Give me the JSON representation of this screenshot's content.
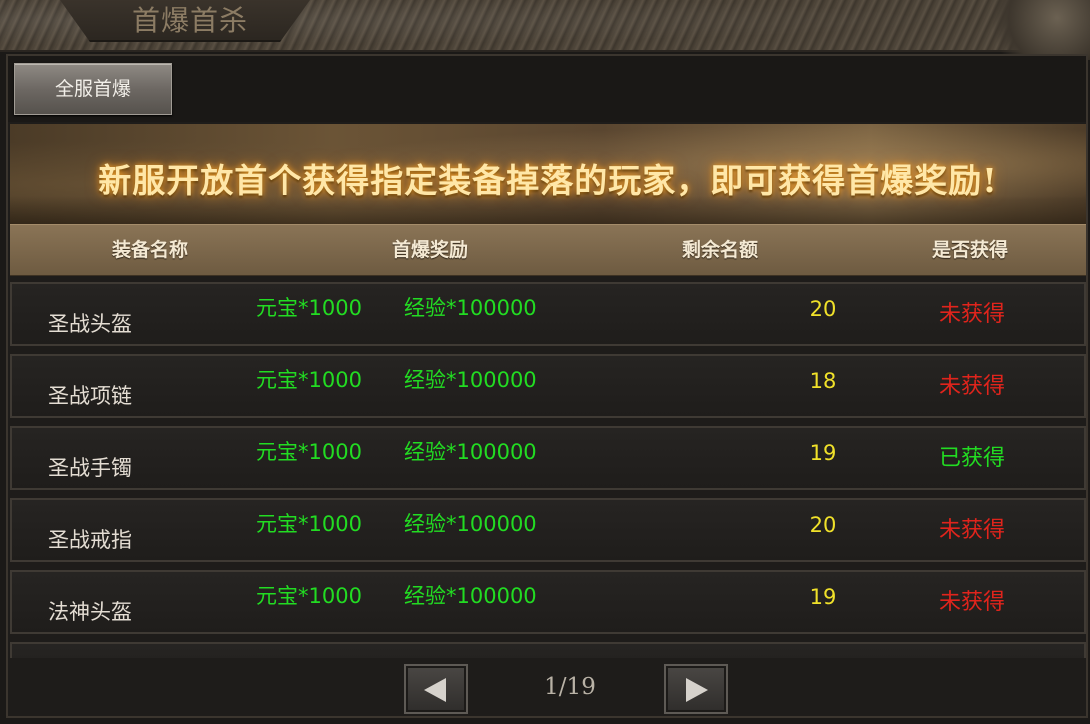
{
  "window": {
    "title": "首爆首杀"
  },
  "tabs": [
    {
      "label": "全服首爆"
    }
  ],
  "banner": {
    "text": "新服开放首个获得指定装备掉落的玩家，即可获得首爆奖励!"
  },
  "table": {
    "headers": [
      "装备名称",
      "首爆奖励",
      "剩余名额",
      "是否获得"
    ],
    "rows": [
      {
        "name": "圣战头盔",
        "reward1": "元宝*1000",
        "reward2": "经验*100000",
        "remaining": "20",
        "status": "未获得",
        "obtained": false
      },
      {
        "name": "圣战项链",
        "reward1": "元宝*1000",
        "reward2": "经验*100000",
        "remaining": "18",
        "status": "未获得",
        "obtained": false
      },
      {
        "name": "圣战手镯",
        "reward1": "元宝*1000",
        "reward2": "经验*100000",
        "remaining": "19",
        "status": "已获得",
        "obtained": true
      },
      {
        "name": "圣战戒指",
        "reward1": "元宝*1000",
        "reward2": "经验*100000",
        "remaining": "20",
        "status": "未获得",
        "obtained": false
      },
      {
        "name": "法神头盔",
        "reward1": "元宝*1000",
        "reward2": "经验*100000",
        "remaining": "19",
        "status": "未获得",
        "obtained": false
      }
    ]
  },
  "pager": {
    "text": "1/19",
    "prev_icon": "arrow-left-icon",
    "next_icon": "arrow-right-icon"
  },
  "colors": {
    "reward": "#22dc22",
    "remaining": "#f0e12a",
    "not_obtained": "#e0241c",
    "obtained": "#22dc22",
    "banner_text": "#ffe7a8"
  }
}
